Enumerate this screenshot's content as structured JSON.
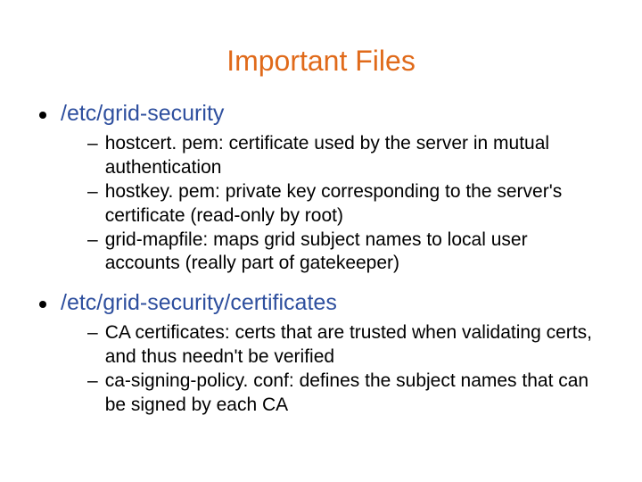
{
  "title": "Important Files",
  "sections": [
    {
      "heading": "/etc/grid-security",
      "items": [
        "hostcert. pem: certificate used by the server in mutual authentication",
        "hostkey. pem: private key corresponding to the server's certificate (read-only by root)",
        "grid-mapfile: maps grid subject names to local user accounts (really part of gatekeeper)"
      ]
    },
    {
      "heading": "/etc/grid-security/certificates",
      "items": [
        "CA certificates: certs that are trusted when validating certs, and thus needn't be verified",
        "ca-signing-policy. conf: defines the subject names that can be signed by each CA"
      ]
    }
  ]
}
